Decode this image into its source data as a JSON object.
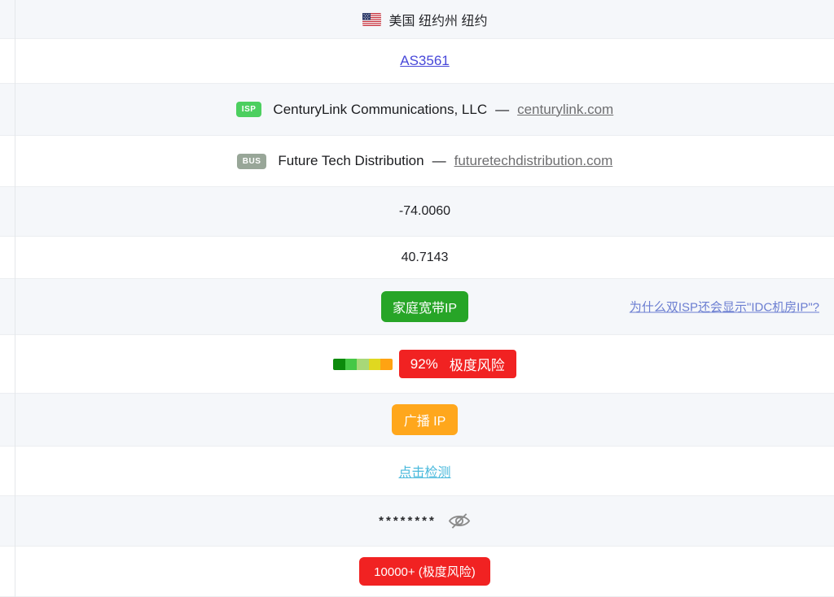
{
  "table": {
    "location": {
      "flag": "us-flag-icon",
      "text": "美国 纽约州 纽约"
    },
    "asn": {
      "link_label": "AS3561"
    },
    "isp": {
      "badge": "ISP",
      "name": "CenturyLink Communications, LLC",
      "dash": "—",
      "domain_link": "centurylink.com"
    },
    "business": {
      "badge": "BUS",
      "name": "Future Tech Distribution",
      "dash": "—",
      "domain_link": "futuretechdistribution.com"
    },
    "longitude": "-74.0060",
    "latitude": "40.7143",
    "ip_type": {
      "button_label": "家庭宽带IP",
      "help_link": "为什么双ISP还会显示\"IDC机房IP\"?"
    },
    "risk_score": {
      "percent": "92%",
      "label": "极度风险",
      "gauge_segments": [
        "#0c8a0c",
        "#46c846",
        "#a8d878",
        "#e0d820",
        "#ffa312"
      ]
    },
    "broadcast": {
      "button_label": "广播 IP"
    },
    "detection": {
      "link_label": "点击检测"
    },
    "masked": {
      "value": "********",
      "icon": "eye-slash-icon"
    },
    "risk_count": {
      "badge_label": "10000+ (极度风险)"
    }
  },
  "colors": {
    "asn_link": "#4747d9",
    "domain_link": "#6e6e70",
    "isp_badge": "#4ccf5f",
    "bus_badge": "#98a698",
    "home_ip_button": "#27a527",
    "help_link": "#6b7ed1",
    "risk_badge": "#f12222",
    "broadcast_button": "#ffa71c",
    "detect_link": "#49b9dc",
    "alt_row_bg": "#f5f7fa"
  }
}
